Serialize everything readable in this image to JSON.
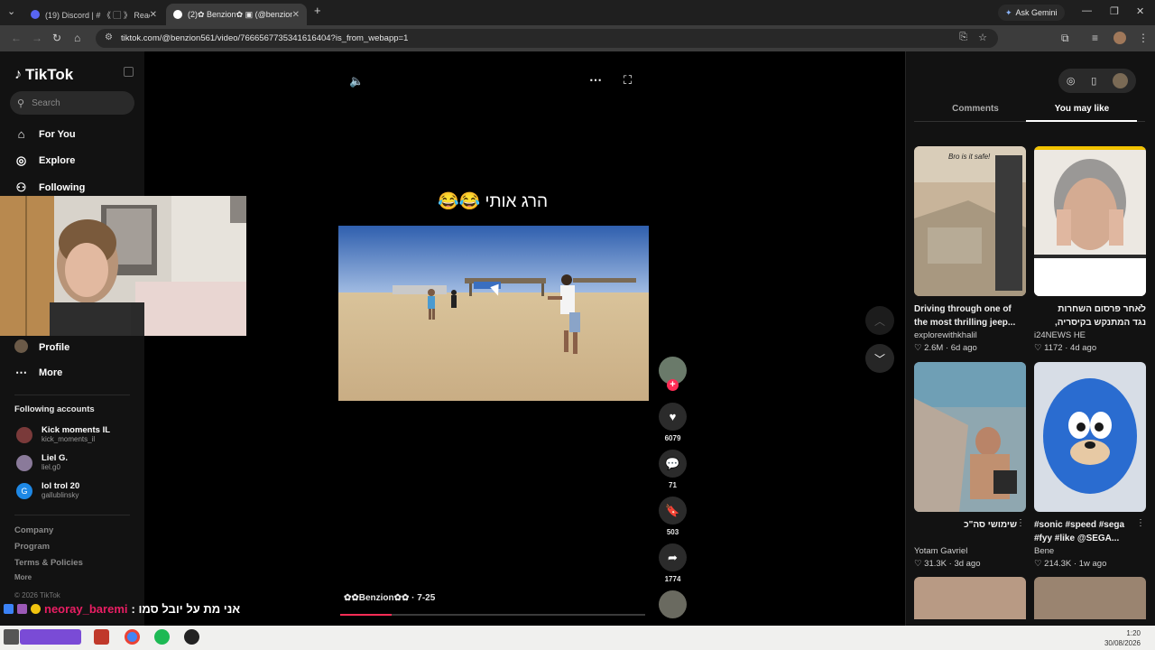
{
  "browser": {
    "tabs": [
      {
        "title": "(19) Discord | # 《 ▢ 》 React-u",
        "active": false,
        "favicon_color": "#5865f2"
      },
      {
        "title": "(2)✿ Benzion✿ ▣ (@benzion",
        "active": true,
        "favicon_color": "#000000"
      }
    ],
    "new_tab": "+",
    "ask_gemini": "Ask Gemini",
    "url": "tiktok.com/@benzion561/video/7666567735341616404?is_from_webapp=1"
  },
  "sidebar": {
    "logo": "TikTok",
    "search_placeholder": "Search",
    "nav": [
      {
        "label": "For You",
        "icon": "home-icon"
      },
      {
        "label": "Explore",
        "icon": "compass-icon"
      },
      {
        "label": "Following",
        "icon": "following-icon"
      },
      {
        "label": "Profile",
        "icon": "profile-avatar"
      },
      {
        "label": "More",
        "icon": "more-icon"
      }
    ],
    "following_title": "Following accounts",
    "following": [
      {
        "name": "Kick moments IL",
        "handle": "kick_moments_il",
        "color": "#7a3a3a"
      },
      {
        "name": "Liel G.",
        "handle": "liel.g0",
        "color": "#8a7a9a"
      },
      {
        "name": "lol trol 20",
        "handle": "gallublinsky",
        "color": "#1e88e5"
      }
    ],
    "footer": [
      "Company",
      "Program",
      "Terms & Policies",
      "More"
    ],
    "copyright": "© 2026 TikTok"
  },
  "video": {
    "caption": "הרג אותי 😂😂",
    "author_label": "✿✿Benzion✿✿ · 7-25",
    "progress_fraction": 0.17,
    "likes": "6079",
    "comments": "71",
    "saves": "503",
    "shares": "1774"
  },
  "right_panel": {
    "tabs": [
      "Comments",
      "You may like"
    ],
    "active_tab": "You may like",
    "cards": [
      {
        "title": "Driving through one of the most thrilling jeep...",
        "user": "explorewithkhalil",
        "likes": "2.6M",
        "age": "6d ago",
        "overlay_text": "Bro is it safe!"
      },
      {
        "title": "לאחר פרסום השחרות נגד המתנקש בקיסריה, שחיטל",
        "user": "i24NEWS HE",
        "likes": "1172",
        "age": "4d ago",
        "overlay_text": ""
      },
      {
        "title": "שימושי סה\"כ",
        "user": "Yotam Gavriel",
        "likes": "31.3K",
        "age": "3d ago",
        "overlay_text": ""
      },
      {
        "title": "#sonic #speed #sega #fyy #like @SEGA...",
        "user": "Bene",
        "likes": "214.3K",
        "age": "1w ago",
        "overlay_text": ""
      }
    ]
  },
  "chat_overlay": {
    "username": "neoray_baremi",
    "message": "אני מת על יובל סמו :"
  },
  "taskbar": {
    "time": "1:20",
    "date": "30/08/2026"
  }
}
